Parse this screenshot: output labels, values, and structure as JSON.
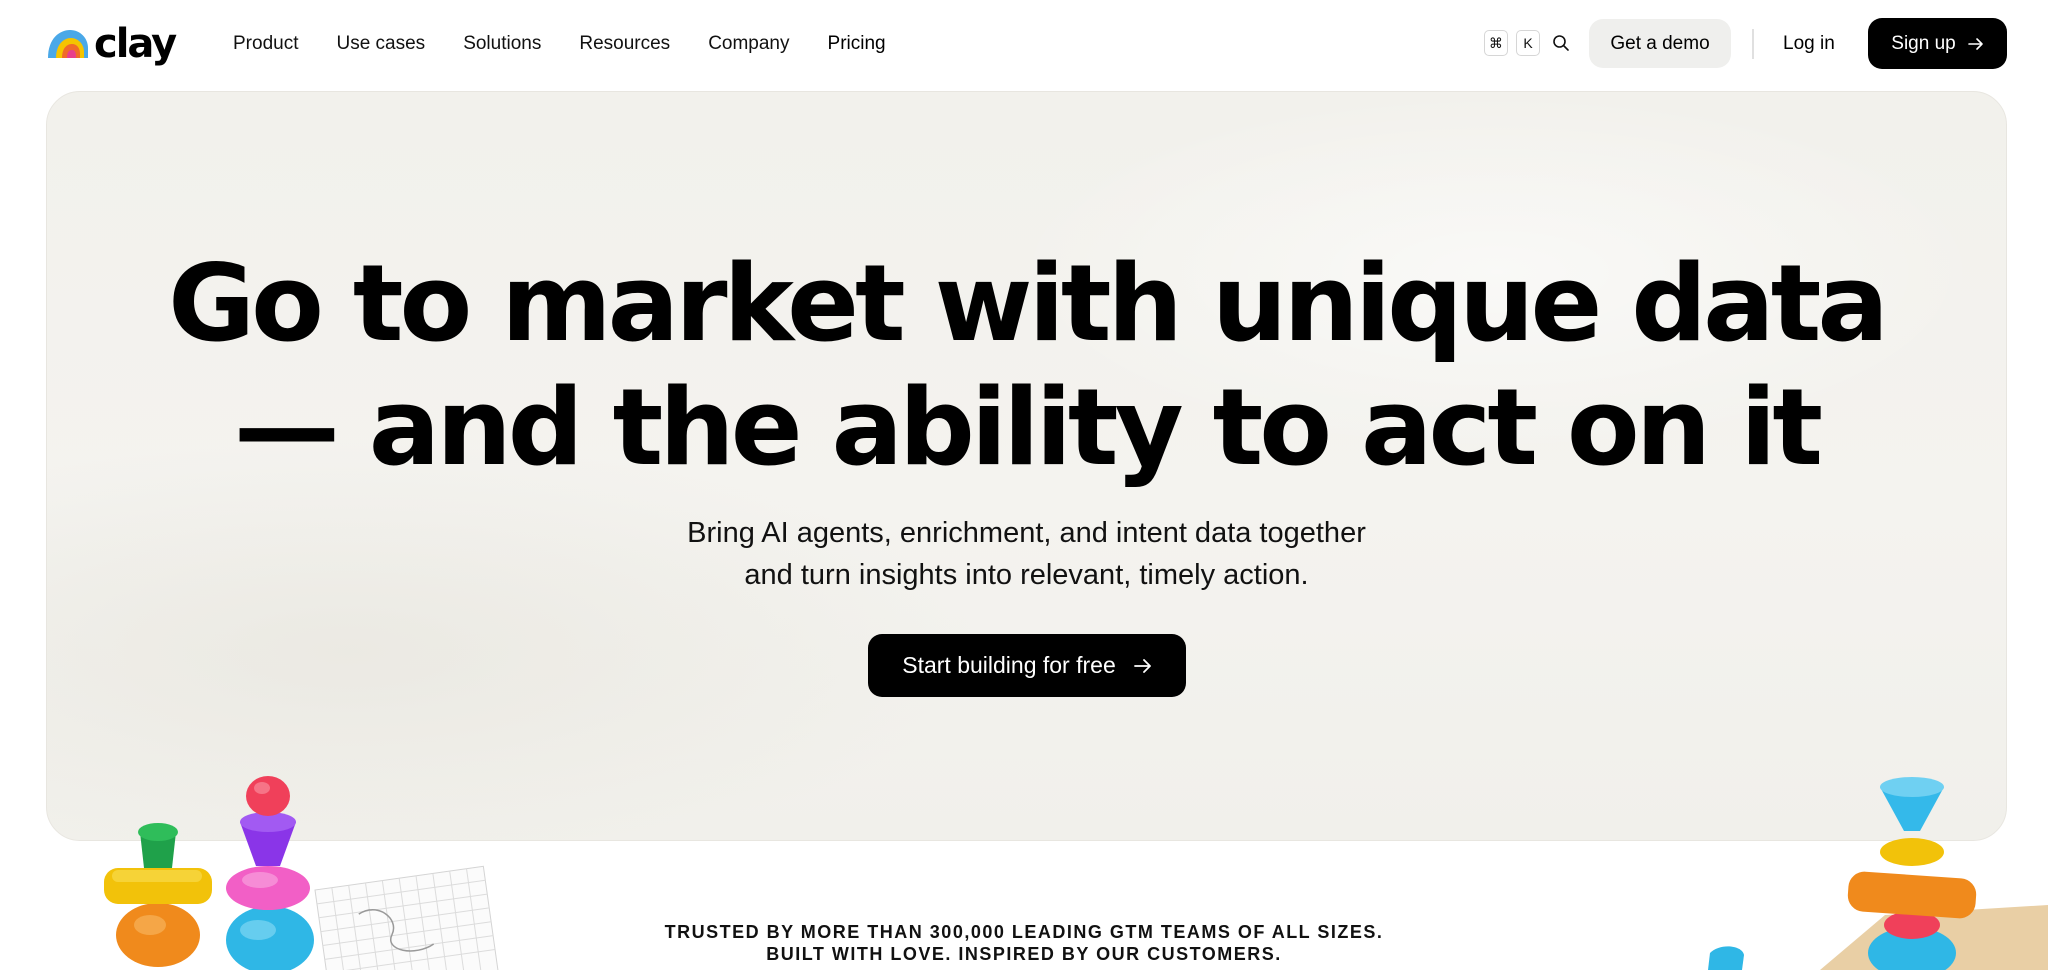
{
  "header": {
    "logo_text": "clay",
    "nav": [
      "Product",
      "Use cases",
      "Solutions",
      "Resources",
      "Company",
      "Pricing"
    ],
    "shortcut_keys": [
      "⌘",
      "K"
    ],
    "demo_label": "Get a demo",
    "login_label": "Log in",
    "signup_label": "Sign up"
  },
  "hero": {
    "title_line1": "Go to market with unique data",
    "title_line2": "— and the ability to act on it",
    "subtitle_line1": "Bring AI agents, enrichment, and intent data together",
    "subtitle_line2": "and turn insights into relevant, timely action.",
    "cta_label": "Start building for free"
  },
  "trusted": {
    "line1": "TRUSTED BY MORE THAN 300,000 LEADING GTM TEAMS OF ALL SIZES.",
    "line2": "BUILT WITH LOVE. INSPIRED BY OUR CUSTOMERS."
  },
  "colors": {
    "accent": "#000000",
    "hero_bg": "#f2f1ec",
    "demo_bg": "#efefed"
  },
  "icons": [
    "logo-icon",
    "search-icon",
    "arrow-right-icon"
  ]
}
